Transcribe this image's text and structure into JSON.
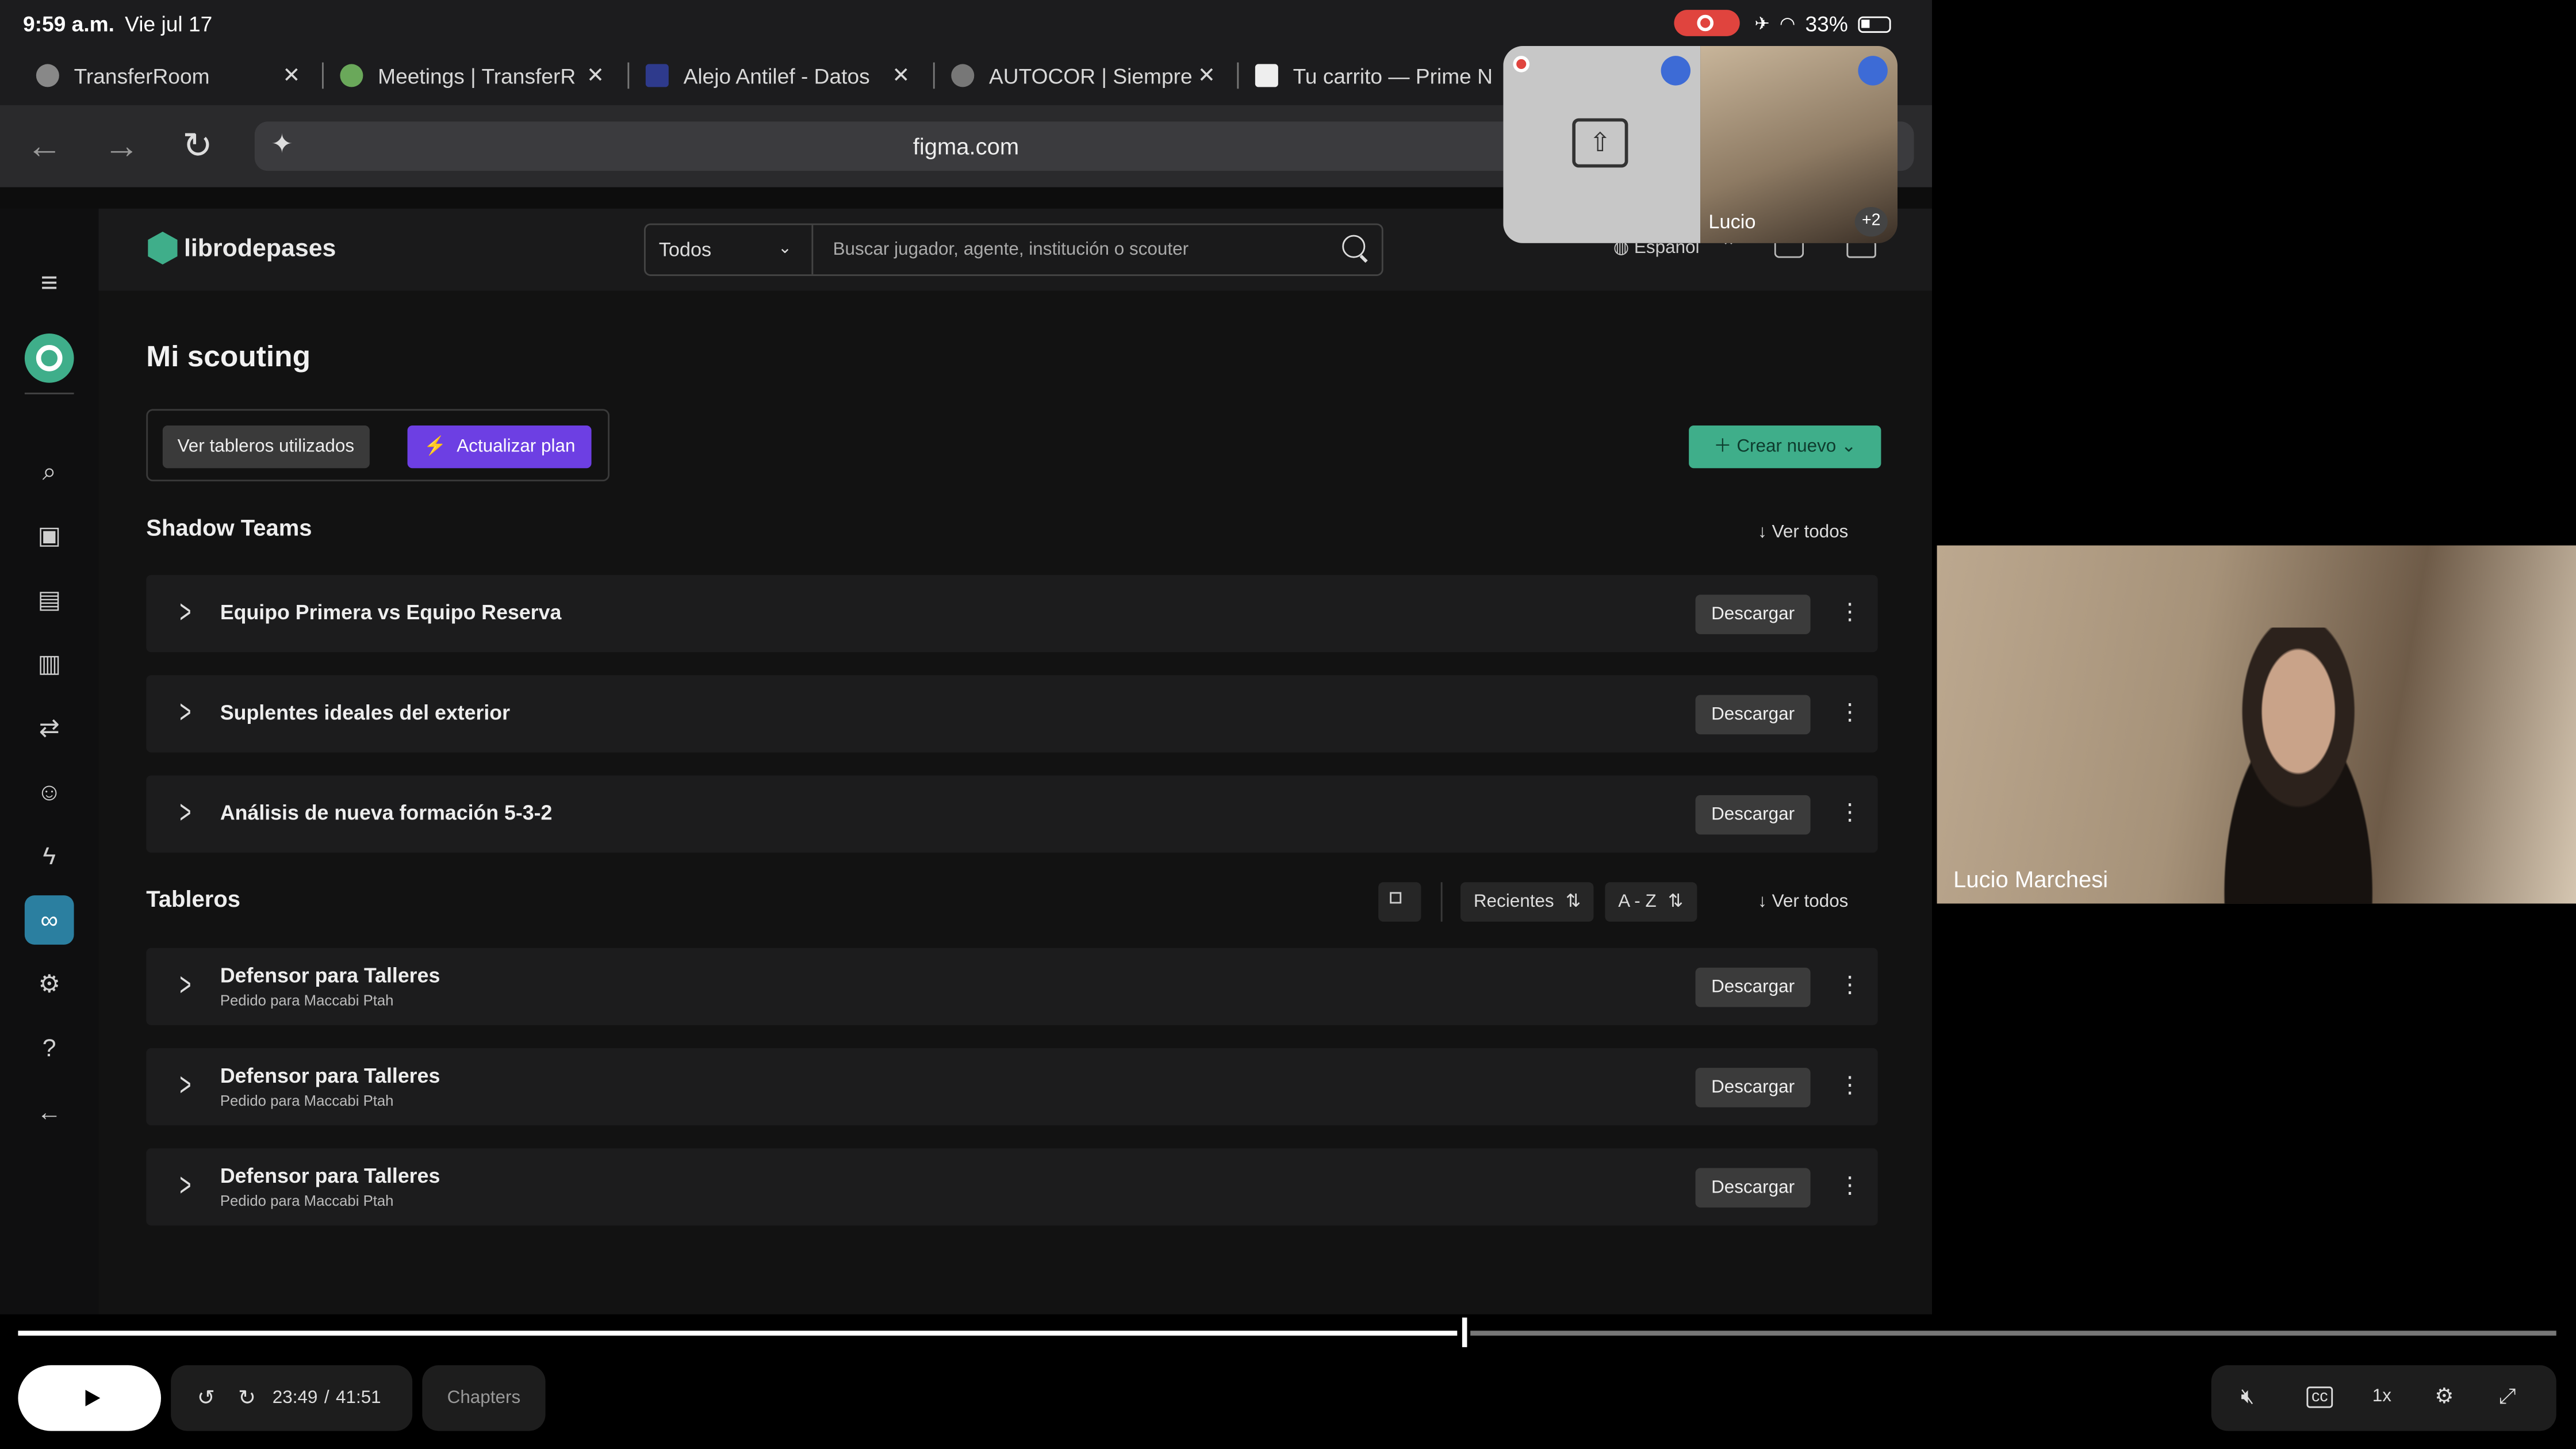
{
  "status_bar": {
    "time": "9:59 a.m.",
    "date": "Vie jul 17",
    "battery": "33%"
  },
  "tabs": [
    {
      "label": "TransferRoom"
    },
    {
      "label": "Meetings | TransferR"
    },
    {
      "label": "Alejo Antilef - Datos"
    },
    {
      "label": "AUTOCOR | Siempre"
    },
    {
      "label": "Tu carrito — Prime N"
    }
  ],
  "browser": {
    "url": "figma.com"
  },
  "app": {
    "brand": "librodepases",
    "search_filter": "Todos",
    "search_placeholder": "Buscar jugador, agente, institución o scouter",
    "language": "Español",
    "page_title": "Mi scouting",
    "btn_ver_tableros": "Ver tableros utilizados",
    "btn_actualizar": "Actualizar plan",
    "btn_crear": "Crear nuevo",
    "shadow_teams": {
      "title": "Shadow Teams",
      "ver_todos": "Ver todos",
      "rows": [
        {
          "title": "Equipo Primera vs Equipo Reserva",
          "action": "Descargar"
        },
        {
          "title": "Suplentes ideales del exterior",
          "action": "Descargar"
        },
        {
          "title": "Análisis de nueva formación 5-3-2",
          "action": "Descargar"
        }
      ]
    },
    "tableros": {
      "title": "Tableros",
      "sort_recent": "Recientes",
      "sort_az": "A - Z",
      "ver_todos": "Ver todos",
      "rows": [
        {
          "title": "Defensor para Talleres",
          "subtitle": "Pedido para Maccabi Ptah",
          "action": "Descargar"
        },
        {
          "title": "Defensor para Talleres",
          "subtitle": "Pedido para Maccabi Ptah",
          "action": "Descargar"
        },
        {
          "title": "Defensor para Talleres",
          "subtitle": "Pedido para Maccabi Ptah",
          "action": "Descargar"
        }
      ]
    }
  },
  "call": {
    "pip_name": "Lucio",
    "pip_extra": "+2",
    "main_name": "Lucio Marchesi"
  },
  "player": {
    "current": "23:49",
    "sep": "/",
    "total": "41:51",
    "chapters": "Chapters",
    "speed": "1x",
    "progress": 0.569
  },
  "colors": {
    "accent_green": "#3fae8a",
    "accent_purple": "#6d3fe3",
    "record_red": "#e0443e"
  }
}
